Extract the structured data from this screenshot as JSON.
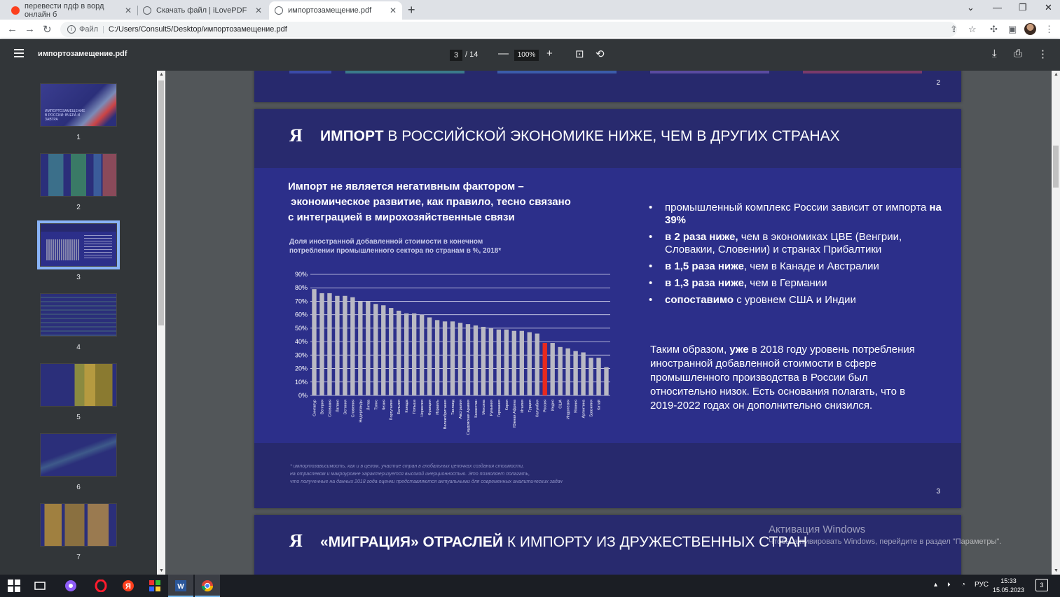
{
  "browser": {
    "tabs": [
      {
        "label": "перевести пдф в ворд онлайн б",
        "icon": "yandex-icon"
      },
      {
        "label": "Скачать файл | iLovePDF",
        "icon": "globe-icon"
      },
      {
        "label": "импортозамещение.pdf",
        "icon": "globe-icon",
        "active": true
      }
    ],
    "address_scheme": "Файл",
    "address": "C:/Users/Consult5/Desktop/импортозамещение.pdf"
  },
  "pdf_toolbar": {
    "title": "импортозамещение.pdf",
    "current_page": "3",
    "total_pages": "/ 14",
    "zoom": "100%"
  },
  "sidebar": {
    "thumbnails": [
      {
        "num": "1",
        "thumb_text": "ИМПОРТОЗАМЕЩЕНИЕ В РОССИИ: ВЧЕРА И ЗАВТРА"
      },
      {
        "num": "2"
      },
      {
        "num": "3",
        "selected": true
      },
      {
        "num": "4"
      },
      {
        "num": "5"
      },
      {
        "num": "6"
      },
      {
        "num": "7"
      }
    ]
  },
  "page2": {
    "number": "2"
  },
  "page3": {
    "logo": "Я",
    "title_bold": "ИМПОРТ",
    "title_rest": " В РОССИЙСКОЙ ЭКОНОМИКЕ НИЖЕ, ЧЕМ В ДРУГИХ СТРАНАХ",
    "lead_1": "Импорт не является негативным фактором –",
    "lead_2": " экономическое развитие, как правило, тесно связано",
    "lead_3": "с интеграцией в мирохозяйственные связи",
    "chart_caption_1": "Доля иностранной добавленной стоимости в конечном",
    "chart_caption_2": "потреблении промышленного сектора по странам в %, 2018*",
    "bullets": [
      {
        "pre": "промышленный комплекс России зависит от импорта ",
        "bold": "на 39%",
        "post": ""
      },
      {
        "pre": "",
        "bold": "в 2 раза ниже,",
        "post": " чем в экономиках ЦВЕ (Венгрии, Словакии, Словении) и странах Прибалтики"
      },
      {
        "pre": "",
        "bold": "в 1,5 раза ниже",
        "post": ", чем в Канаде и Австралии"
      },
      {
        "pre": "",
        "bold": "в 1,3 раза ниже,",
        "post": " чем в Германии"
      },
      {
        "pre": "",
        "bold": "сопоставимо",
        "post": " с уровнем США и Индии"
      }
    ],
    "conclusion_pre": "Таким образом, ",
    "conclusion_bold": "уже",
    "conclusion_post": " в 2018 году уровень потребления иностранной добавленной стоимости в сфере промышленного производства в России был относительно низок. Есть основания полагать, что в 2019-2022 годах он дополнительно снизился.",
    "footnote_1": "* импортозависимость, как и в целом, участие стран в глобальных цепочках создания стоимости,",
    "footnote_2": "на отраслевом и макроуровне характеризуется высокой инерционностью. Это позволяет полагать,",
    "footnote_3": "что полученные на данных 2018 года оценки представляются актуальными для современных аналитических задач",
    "number": "3"
  },
  "page4": {
    "logo": "Я",
    "title_bold": "«МИГРАЦИЯ» ОТРАСЛЕЙ",
    "title_rest": " К ИМПОРТУ ИЗ ДРУЖЕСТВЕННЫХ СТРАН"
  },
  "activation": {
    "line1": "Активация Windows",
    "line2": "Чтобы активировать Windows, перейдите в раздел \"Параметры\"."
  },
  "taskbar": {
    "lang": "РУС",
    "time": "15:33",
    "date": "15.05.2023",
    "notifications": "3"
  },
  "colors": {
    "slide_bg": "#2c2f8a",
    "slide_header_bg": "#282a6e",
    "bar": "#b9b9c4",
    "bar_highlight": "#e8291e"
  },
  "chart_data": {
    "type": "bar",
    "ylim": [
      0,
      90
    ],
    "yticks": [
      "0%",
      "10%",
      "20%",
      "30%",
      "40%",
      "50%",
      "60%",
      "70%",
      "80%",
      "90%"
    ],
    "highlight": "Россия",
    "categories": [
      "Сингапур",
      "Венгрия",
      "Словакия",
      "Латвия",
      "Эстония",
      "Словения",
      "Нидерланды",
      "Литва",
      "Тунис",
      "Чехия",
      "Португалия",
      "Бельгия",
      "Канада",
      "Польша",
      "Норвегия",
      "Франция",
      "Израиль",
      "Великобритания",
      "Таиланд",
      "Австралия",
      "Саудовская Аравия",
      "Казахстан",
      "Мексика",
      "Румыния",
      "Германия",
      "Корея",
      "Южная Африка",
      "Италия",
      "Турция",
      "Колумбия",
      "Россия",
      "Индия",
      "США",
      "Индонезия",
      "Япония",
      "Аргентина",
      "Бразилия",
      "Китай"
    ],
    "values": [
      79,
      76,
      76,
      74,
      74,
      73,
      70,
      70,
      68,
      67,
      65,
      63,
      61,
      61,
      60,
      58,
      56,
      55,
      55,
      54,
      53,
      52,
      51,
      50,
      49,
      49,
      48,
      48,
      47,
      46,
      39,
      39,
      36,
      35,
      33,
      32,
      28,
      28,
      21
    ]
  }
}
